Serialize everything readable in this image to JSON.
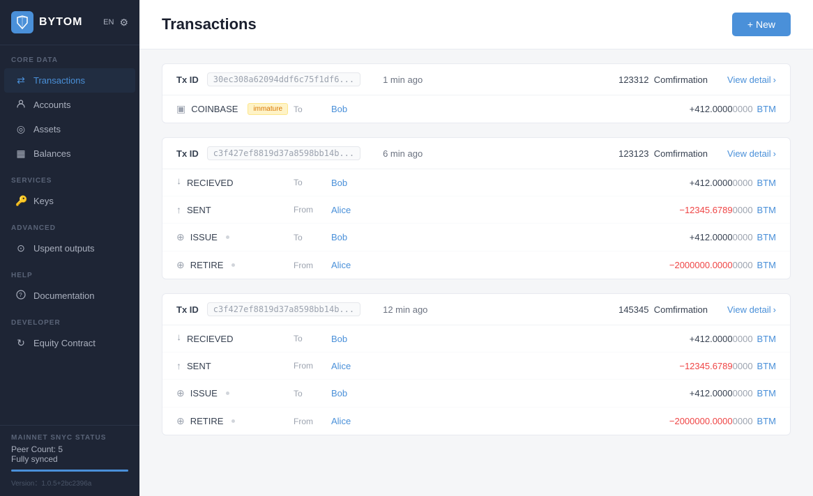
{
  "sidebar": {
    "logo": "BYTOM",
    "lang": "EN",
    "sections": [
      {
        "label": "CORE DATA",
        "items": [
          {
            "id": "transactions",
            "label": "Transactions",
            "icon": "⇄",
            "active": true
          },
          {
            "id": "accounts",
            "label": "Accounts",
            "icon": "👤"
          },
          {
            "id": "assets",
            "label": "Assets",
            "icon": "◎"
          },
          {
            "id": "balances",
            "label": "Balances",
            "icon": "▦"
          }
        ]
      },
      {
        "label": "SERVICES",
        "items": [
          {
            "id": "keys",
            "label": "Keys",
            "icon": "🔑"
          }
        ]
      },
      {
        "label": "ADVANCED",
        "items": [
          {
            "id": "unspent",
            "label": "Uspent outputs",
            "icon": "⊙"
          }
        ]
      },
      {
        "label": "HELP",
        "items": [
          {
            "id": "documentation",
            "label": "Documentation",
            "icon": "❓"
          }
        ]
      },
      {
        "label": "DEVELOPER",
        "items": [
          {
            "id": "equity",
            "label": "Equity Contract",
            "icon": "↻"
          }
        ]
      }
    ],
    "sync_section_label": "MAINNET SNYC STATUS",
    "peer_count": "Peer Count: 5",
    "sync_status": "Fully synced",
    "version": "Version：1.0.5+2bc2396a"
  },
  "header": {
    "title": "Transactions",
    "new_button": "+ New"
  },
  "transactions": [
    {
      "tx_id_label": "Tx ID",
      "tx_hash": "30ec308a62094ddf6c75f1df6...",
      "time": "1 min ago",
      "confirmation_num": "123312",
      "confirmation_label": "Comfirmation",
      "view_detail": "View detail",
      "rows": [
        {
          "type": "COINBASE",
          "type_icon": "▣",
          "badge": "immature",
          "direction": "To",
          "counterparty": "Bob",
          "amount_sign": "+",
          "amount_main": " 412.0000",
          "amount_decimal": "0000",
          "currency": "BTM"
        }
      ]
    },
    {
      "tx_id_label": "Tx ID",
      "tx_hash": "c3f427ef8819d37a8598bb14b...",
      "time": "6 min ago",
      "confirmation_num": "123123",
      "confirmation_label": "Comfirmation",
      "view_detail": "View detail",
      "rows": [
        {
          "type": "RECIEVED",
          "type_icon": "↑",
          "direction": "To",
          "counterparty": "Bob",
          "amount_sign": "+",
          "amount_main": " 412.0000",
          "amount_decimal": "0000",
          "currency": "BTM"
        },
        {
          "type": "SENT",
          "type_icon": "↑",
          "direction": "From",
          "counterparty": "Alice",
          "amount_sign": "−",
          "amount_main": " 12345.6789",
          "amount_decimal": "0000",
          "currency": "BTM",
          "negative": true
        },
        {
          "type": "ISSUE",
          "type_icon": "⊕",
          "direction": "To",
          "counterparty": "Bob",
          "amount_sign": "+",
          "amount_main": " 412.0000",
          "amount_decimal": "0000",
          "currency": "BTM"
        },
        {
          "type": "RETIRE",
          "type_icon": "⊕",
          "direction": "From",
          "counterparty": "Alice",
          "amount_sign": "−",
          "amount_main": " 2000000.0000",
          "amount_decimal": "0000",
          "currency": "BTM",
          "negative": true
        }
      ]
    },
    {
      "tx_id_label": "Tx ID",
      "tx_hash": "c3f427ef8819d37a8598bb14b...",
      "time": "12 min ago",
      "confirmation_num": "145345",
      "confirmation_label": "Comfirmation",
      "view_detail": "View detail",
      "rows": [
        {
          "type": "RECIEVED",
          "type_icon": "↑",
          "direction": "To",
          "counterparty": "Bob",
          "amount_sign": "+",
          "amount_main": " 412.0000",
          "amount_decimal": "0000",
          "currency": "BTM"
        },
        {
          "type": "SENT",
          "type_icon": "↑",
          "direction": "From",
          "counterparty": "Alice",
          "amount_sign": "−",
          "amount_main": " 12345.6789",
          "amount_decimal": "0000",
          "currency": "BTM",
          "negative": true
        },
        {
          "type": "ISSUE",
          "type_icon": "⊕",
          "direction": "To",
          "counterparty": "Bob",
          "amount_sign": "+",
          "amount_main": " 412.0000",
          "amount_decimal": "0000",
          "currency": "BTM"
        },
        {
          "type": "RETIRE",
          "type_icon": "⊕",
          "direction": "From",
          "counterparty": "Alice",
          "amount_sign": "−",
          "amount_main": " 2000000.0000",
          "amount_decimal": "0000",
          "currency": "BTM",
          "negative": true
        }
      ]
    }
  ]
}
